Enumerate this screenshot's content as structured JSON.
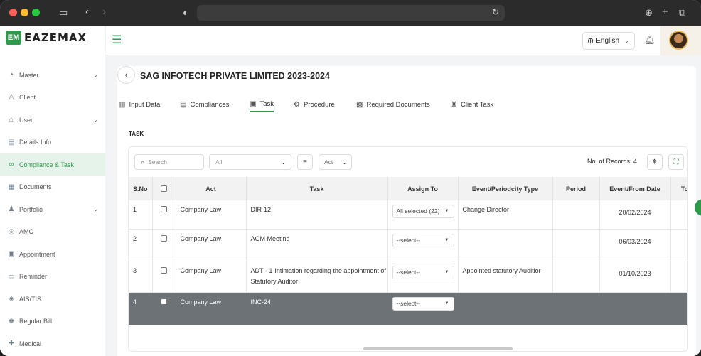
{
  "brand": {
    "name": "EAZEMAX",
    "mark": "EM",
    "accent": "#2f9a4b"
  },
  "sidebar": {
    "items": [
      {
        "label": "Master",
        "icon": "flask-icon",
        "has_submenu": true,
        "active": false
      },
      {
        "label": "Client",
        "icon": "person-icon",
        "has_submenu": false,
        "active": false
      },
      {
        "label": "User",
        "icon": "home-icon",
        "has_submenu": true,
        "active": false
      },
      {
        "label": "Details Info",
        "icon": "document-icon",
        "has_submenu": false,
        "active": false
      },
      {
        "label": "Compliance & Task",
        "icon": "link-icon",
        "has_submenu": false,
        "active": true
      },
      {
        "label": "Documents",
        "icon": "folder-icon",
        "has_submenu": false,
        "active": false
      },
      {
        "label": "Portfolio",
        "icon": "portfolio-icon",
        "has_submenu": true,
        "active": false
      },
      {
        "label": "AMC",
        "icon": "amc-icon",
        "has_submenu": false,
        "active": false
      },
      {
        "label": "Appointment",
        "icon": "calendar-icon",
        "has_submenu": false,
        "active": false
      },
      {
        "label": "Reminder",
        "icon": "reminder-icon",
        "has_submenu": false,
        "active": false
      },
      {
        "label": "AIS/TIS",
        "icon": "tag-icon",
        "has_submenu": false,
        "active": false
      },
      {
        "label": "Regular Bill",
        "icon": "bill-icon",
        "has_submenu": false,
        "active": false
      },
      {
        "label": "Medical",
        "icon": "medical-icon",
        "has_submenu": false,
        "active": false
      }
    ]
  },
  "topbar": {
    "language": "English"
  },
  "page": {
    "title": "SAG INFOTECH PRIVATE LIMITED 2023-2024",
    "tabs": [
      {
        "label": "Input Data",
        "icon": "input-icon",
        "active": false
      },
      {
        "label": "Compliances",
        "icon": "compliance-icon",
        "active": false
      },
      {
        "label": "Task",
        "icon": "task-icon",
        "active": true
      },
      {
        "label": "Procedure",
        "icon": "procedure-icon",
        "active": false
      },
      {
        "label": "Required Documents",
        "icon": "documents-icon",
        "active": false
      },
      {
        "label": "Client Task",
        "icon": "client-task-icon",
        "active": false
      }
    ],
    "section_label": "TASK"
  },
  "toolbar": {
    "search_placeholder": "Search",
    "filter_select": "All",
    "act_select": "Act",
    "records": "No. of Records: 4"
  },
  "table": {
    "headers": [
      "S.No",
      "",
      "Act",
      "Task",
      "Assign To",
      "Event/Periodcity Type",
      "Period",
      "Event/From Date",
      "To Date"
    ],
    "rows": [
      {
        "sno": "1",
        "act": "Company Law",
        "task": "DIR-12",
        "assign": "All selected (22)",
        "event": "Change Director",
        "period": "",
        "from_date": "20/02/2024",
        "to_date": ""
      },
      {
        "sno": "2",
        "act": "Company Law",
        "task": "AGM Meeting",
        "assign": "--select--",
        "event": "",
        "period": "",
        "from_date": "06/03/2024",
        "to_date": ""
      },
      {
        "sno": "3",
        "act": "Company Law",
        "task": "ADT - 1-Intimation regarding the appointment of Statutory Auditor",
        "assign": "--select--",
        "event": "Appointed statutory Auditior",
        "period": "",
        "from_date": "01/10/2023",
        "to_date": ""
      },
      {
        "sno": "4",
        "act": "Company Law",
        "task": "INC-24",
        "assign": "--select--",
        "event": "",
        "period": "",
        "from_date": "",
        "to_date": ""
      }
    ]
  }
}
